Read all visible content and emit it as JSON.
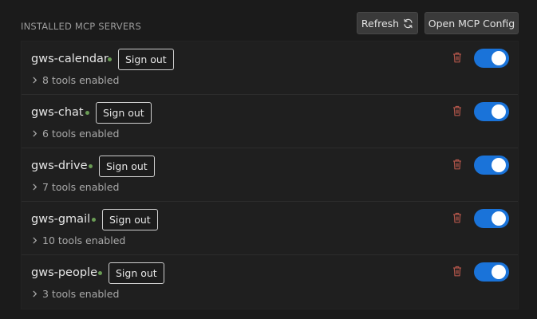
{
  "header": {
    "title": "INSTALLED MCP SERVERS",
    "refresh_label": "Refresh",
    "open_config_label": "Open MCP Config"
  },
  "servers": [
    {
      "name": "gws-calendar",
      "sign_out_label": "Sign out",
      "tools_label": "8 tools enabled",
      "enabled": true,
      "status": "connected"
    },
    {
      "name": "gws-chat",
      "sign_out_label": "Sign out",
      "tools_label": "6 tools enabled",
      "enabled": true,
      "status": "connected"
    },
    {
      "name": "gws-drive",
      "sign_out_label": "Sign out",
      "tools_label": "7 tools enabled",
      "enabled": true,
      "status": "connected"
    },
    {
      "name": "gws-gmail",
      "sign_out_label": "Sign out",
      "tools_label": "10 tools enabled",
      "enabled": true,
      "status": "connected"
    },
    {
      "name": "gws-people",
      "sign_out_label": "Sign out",
      "tools_label": "3 tools enabled",
      "enabled": true,
      "status": "connected"
    }
  ],
  "colors": {
    "toggle_on": "#1a73d9",
    "status_connected": "#6a9c55",
    "trash_icon": "#b0554a"
  },
  "icons": {
    "refresh": "refresh-icon",
    "delete": "trash-icon",
    "expand": "chevron-right-icon",
    "status": "status-dot"
  }
}
